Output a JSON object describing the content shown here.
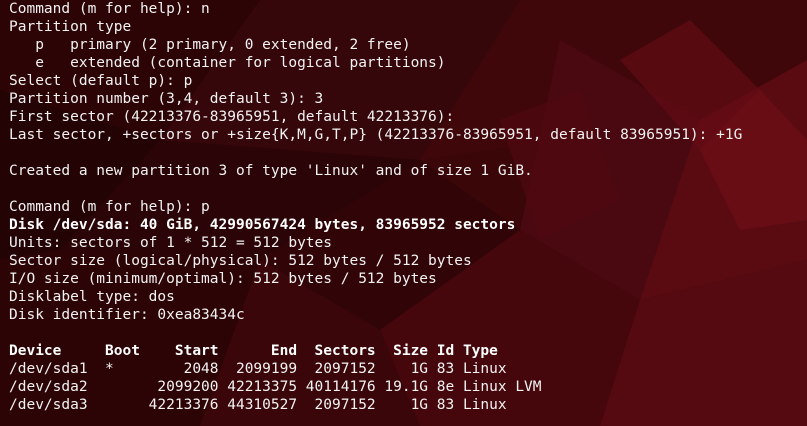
{
  "terminal": {
    "lines": [
      {
        "text": "Command (m for help): n",
        "bold": false
      },
      {
        "text": "Partition type",
        "bold": false
      },
      {
        "text": "   p   primary (2 primary, 0 extended, 2 free)",
        "bold": false
      },
      {
        "text": "   e   extended (container for logical partitions)",
        "bold": false
      },
      {
        "text": "Select (default p): p",
        "bold": false
      },
      {
        "text": "Partition number (3,4, default 3): 3",
        "bold": false
      },
      {
        "text": "First sector (42213376-83965951, default 42213376):",
        "bold": false
      },
      {
        "text": "Last sector, +sectors or +size{K,M,G,T,P} (42213376-83965951, default 83965951): +1G",
        "bold": false
      },
      {
        "text": "",
        "bold": false
      },
      {
        "text": "Created a new partition 3 of type 'Linux' and of size 1 GiB.",
        "bold": false
      },
      {
        "text": "",
        "bold": false
      },
      {
        "text": "Command (m for help): p",
        "bold": false
      },
      {
        "text": "Disk /dev/sda: 40 GiB, 42990567424 bytes, 83965952 sectors",
        "bold": true
      },
      {
        "text": "Units: sectors of 1 * 512 = 512 bytes",
        "bold": false
      },
      {
        "text": "Sector size (logical/physical): 512 bytes / 512 bytes",
        "bold": false
      },
      {
        "text": "I/O size (minimum/optimal): 512 bytes / 512 bytes",
        "bold": false
      },
      {
        "text": "Disklabel type: dos",
        "bold": false
      },
      {
        "text": "Disk identifier: 0xea83434c",
        "bold": false
      },
      {
        "text": "",
        "bold": false
      },
      {
        "text": "Device     Boot    Start      End  Sectors  Size Id Type",
        "bold": true
      },
      {
        "text": "/dev/sda1  *        2048  2099199  2097152    1G 83 Linux",
        "bold": false
      },
      {
        "text": "/dev/sda2        2099200 42213375 40114176 19.1G 8e Linux LVM",
        "bold": false
      },
      {
        "text": "/dev/sda3       42213376 44310527  2097152    1G 83 Linux",
        "bold": false
      }
    ]
  },
  "colors": {
    "background": "#3a0608",
    "text": "#f2f2f2",
    "bold_text": "#ffffff"
  }
}
